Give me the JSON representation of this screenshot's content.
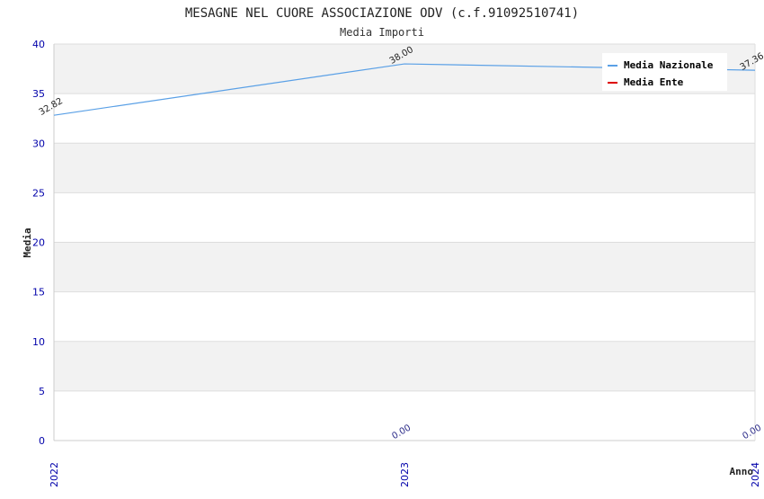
{
  "chart_data": {
    "type": "line",
    "title": "MESAGNE NEL CUORE ASSOCIAZIONE ODV (c.f.91092510741)",
    "subtitle": "Media Importi",
    "xlabel": "Anno",
    "ylabel": "Media",
    "categories": [
      "2022",
      "2023",
      "2024"
    ],
    "ylim": [
      0,
      40
    ],
    "yticks": [
      "0",
      "5",
      "10",
      "15",
      "20",
      "25",
      "30",
      "35",
      "40"
    ],
    "grid": "horizontal bands",
    "legend_position": "top-right",
    "series": [
      {
        "name": "Media Nazionale",
        "color": "#5aa0e6",
        "values": [
          32.82,
          38.0,
          37.36
        ],
        "labels": [
          "32.82",
          "38.00",
          "37.36"
        ]
      },
      {
        "name": "Media Ente",
        "color": "#dd0000",
        "values": [
          null,
          0.0,
          0.0
        ],
        "labels": [
          "",
          "0.00",
          "0.00"
        ]
      }
    ]
  }
}
